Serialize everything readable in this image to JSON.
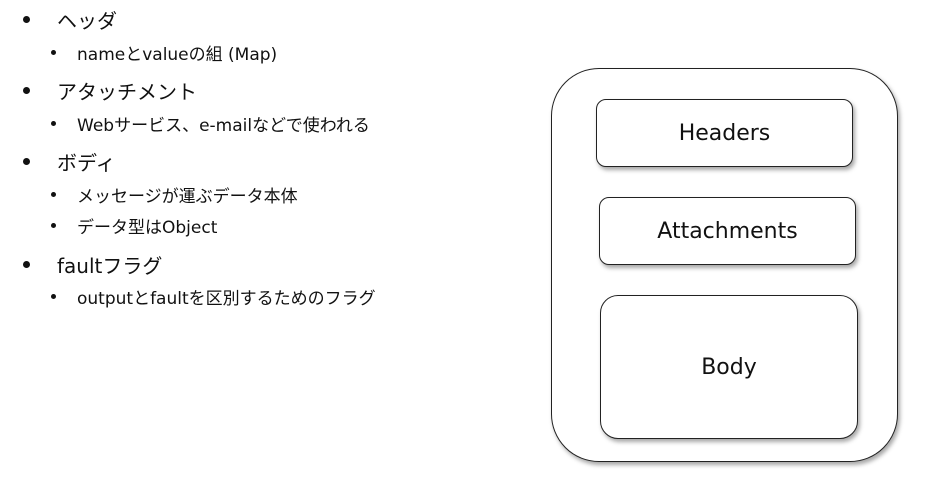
{
  "bullets": [
    {
      "label": "ヘッダ",
      "children": [
        "nameとvalueの組 (Map)"
      ]
    },
    {
      "label": "アタッチメント",
      "children": [
        "Webサービス、e-mailなどで使われる"
      ]
    },
    {
      "label": "ボディ",
      "children": [
        "メッセージが運ぶデータ本体",
        "データ型はObject"
      ]
    },
    {
      "label": "faultフラグ",
      "children": [
        "outputとfaultを区別するためのフラグ"
      ]
    }
  ],
  "diagram": {
    "boxes": [
      "Headers",
      "Attachments",
      "Body"
    ]
  }
}
